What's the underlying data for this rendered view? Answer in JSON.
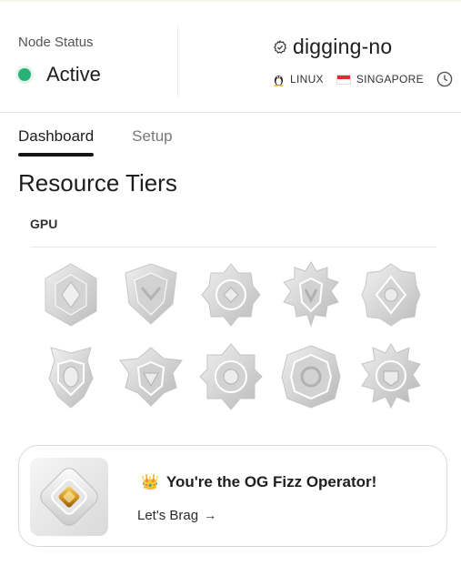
{
  "status": {
    "label": "Node Status",
    "value": "Active",
    "color": "#28b276"
  },
  "node": {
    "name": "digging-no",
    "os": "LINUX",
    "region": "SINGAPORE"
  },
  "tabs": [
    {
      "label": "Dashboard",
      "active": true
    },
    {
      "label": "Setup",
      "active": false
    }
  ],
  "resource_tiers": {
    "title": "Resource Tiers",
    "group_label": "GPU",
    "badges": [
      "tier-badge-1",
      "tier-badge-2",
      "tier-badge-3",
      "tier-badge-4",
      "tier-badge-5",
      "tier-badge-6",
      "tier-badge-7",
      "tier-badge-8",
      "tier-badge-9",
      "tier-badge-10"
    ]
  },
  "brag": {
    "title": "You're the OG Fizz Operator!",
    "link": "Let's Brag",
    "arrow": "→",
    "crown_icon": "crown-icon"
  }
}
